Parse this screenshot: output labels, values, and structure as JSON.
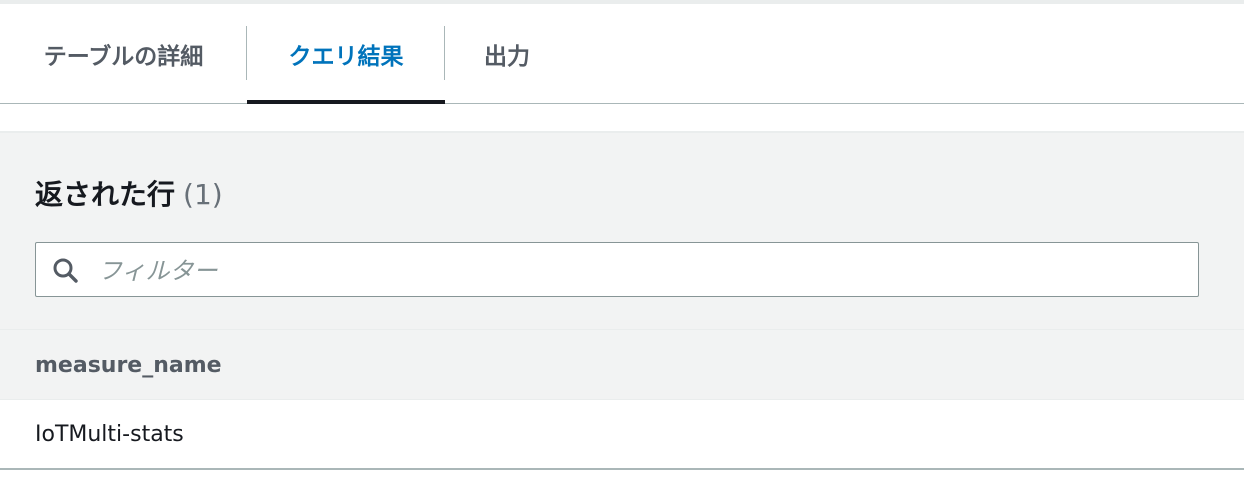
{
  "tabs": [
    {
      "label": "テーブルの詳細",
      "active": false
    },
    {
      "label": "クエリ結果",
      "active": true
    },
    {
      "label": "出力",
      "active": false
    }
  ],
  "results": {
    "title": "返された行",
    "count": "(1)"
  },
  "filter": {
    "placeholder": "フィルター",
    "icon": "search-icon"
  },
  "table": {
    "columns": [
      "measure_name"
    ],
    "rows": [
      [
        "IoTMulti-stats"
      ]
    ]
  },
  "colors": {
    "active_tab": "#0073bb",
    "inactive_tab": "#545b64",
    "panel_bg": "#f2f3f3",
    "text": "#16191f"
  }
}
